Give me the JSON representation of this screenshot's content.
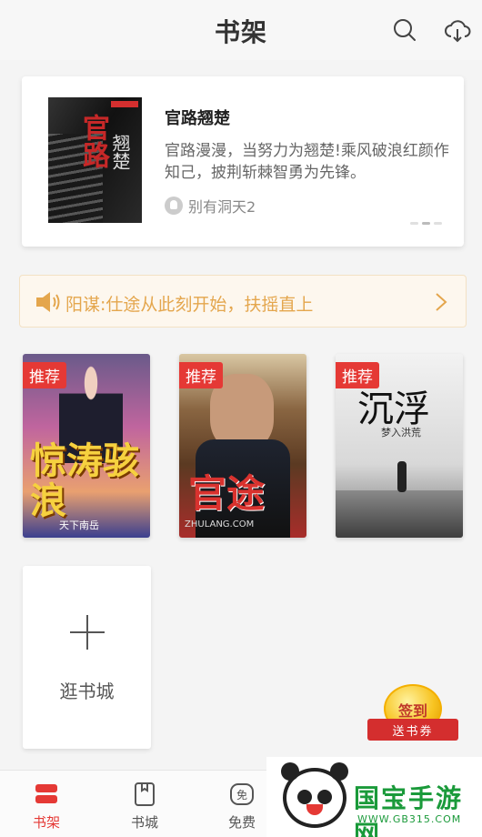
{
  "header": {
    "title": "书架",
    "icons": [
      "search-icon",
      "cloud-download-icon"
    ]
  },
  "featured": {
    "title": "官路翘楚",
    "description": "官路漫漫，当努力为翘楚!乘风破浪红颜作知己，披荆斩棘智勇为先锋。",
    "author": "别有洞天2",
    "carousel_pages": 3,
    "carousel_active": 2
  },
  "notice": {
    "text": "阳谋:仕途从此刻开始，扶摇直上",
    "icon": "speaker-icon",
    "color": "#e4a64d"
  },
  "books": [
    {
      "tag": "推荐",
      "cover_title": "惊涛骇浪",
      "cover_author": "天下南岳"
    },
    {
      "tag": "推荐",
      "cover_title": "官途",
      "cover_author": "ZHULANG.COM"
    },
    {
      "tag": "推荐",
      "cover_title": "沉浮",
      "cover_author": "梦入洪荒"
    }
  ],
  "add_card": {
    "label": "逛书城"
  },
  "checkin": {
    "label": "签到",
    "ribbon": "送书券"
  },
  "tabs": [
    {
      "label": "书架",
      "icon": "bookshelf-icon",
      "active": true
    },
    {
      "label": "书城",
      "icon": "bookstore-icon",
      "active": false
    },
    {
      "label": "免费",
      "icon": "free-icon",
      "active": false
    }
  ],
  "watermark": {
    "title": "国宝手游网",
    "url": "WWW.GB315.COM"
  },
  "colors": {
    "accent": "#e53935",
    "notice_bg": "#fdf7ee"
  }
}
